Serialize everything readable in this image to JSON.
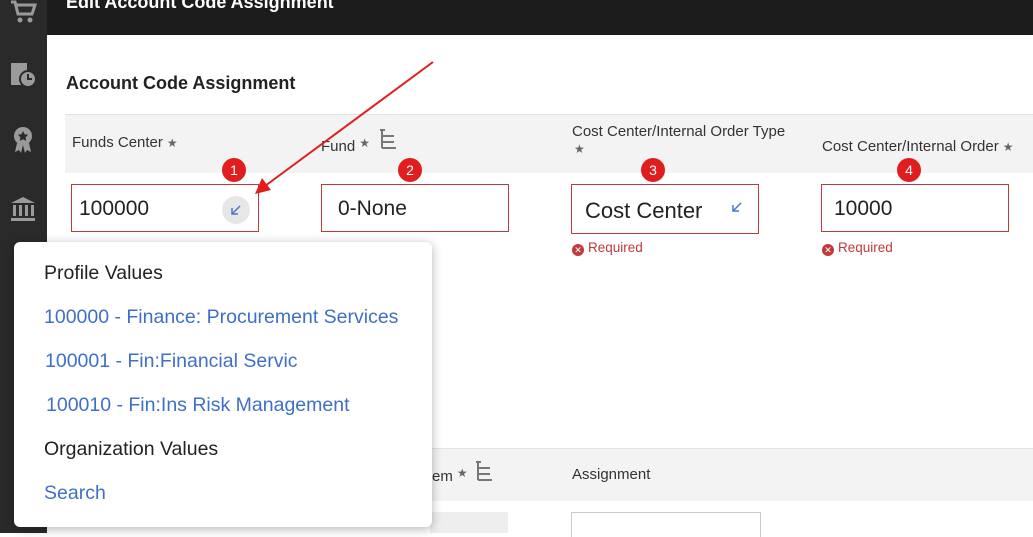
{
  "header": {
    "title": "Edit Account Code Assignment"
  },
  "section": {
    "title": "Account Code Assignment"
  },
  "columns": [
    {
      "label": "Funds Center"
    },
    {
      "label": "Fund"
    },
    {
      "label": "Cost Center/Internal Order Type"
    },
    {
      "label": "Cost Center/Internal Order"
    }
  ],
  "fields": {
    "funds_center": "100000",
    "fund": "0-None",
    "cost_center_type": "Cost Center",
    "cost_center": "10000"
  },
  "badges": [
    "1",
    "2",
    "3",
    "4"
  ],
  "validation": {
    "required_label": "Required"
  },
  "lower_table": {
    "item_label_fragment": "em",
    "assignment_label": "Assignment"
  },
  "popup": {
    "profile_values_heading": "Profile Values",
    "profile_values": [
      "100000 - Finance: Procurement Services",
      "100001 - Fin:Financial Servic",
      "100010 - Fin:Ins Risk Management"
    ],
    "organization_values_heading": "Organization Values",
    "search_label": "Search"
  },
  "colors": {
    "accent_link": "#3f6fc8",
    "error": "#c0393b",
    "badge": "#e01e1e",
    "annotation_arrow": "#e01e1e"
  }
}
